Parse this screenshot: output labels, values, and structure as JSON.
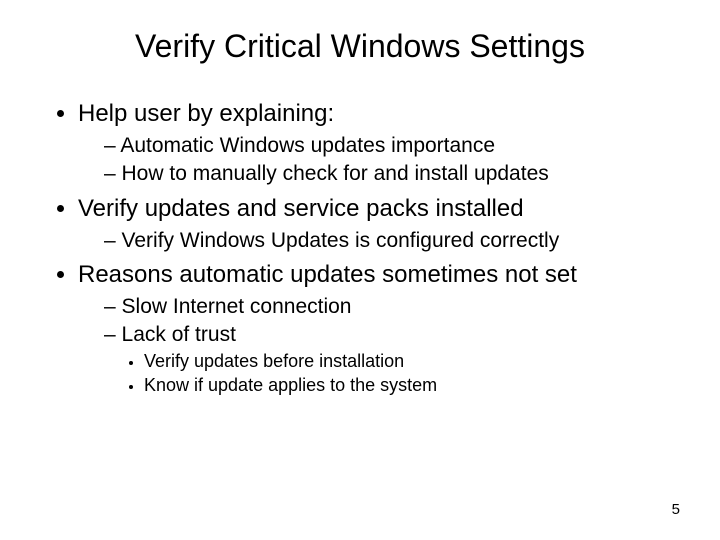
{
  "title": "Verify Critical Windows Settings",
  "bullets": [
    {
      "text": "Help user by explaining:",
      "sub": [
        {
          "text": "Automatic Windows updates importance"
        },
        {
          "text": "How to manually check for and install updates"
        }
      ]
    },
    {
      "text": "Verify updates and service packs installed",
      "sub": [
        {
          "text": "Verify Windows Updates is configured correctly"
        }
      ]
    },
    {
      "text": "Reasons automatic updates sometimes not set",
      "sub": [
        {
          "text": "Slow Internet connection"
        },
        {
          "text": "Lack of trust",
          "sub": [
            {
              "text": "Verify updates before installation"
            },
            {
              "text": "Know if update applies to the system"
            }
          ]
        }
      ]
    }
  ],
  "page_number": "5"
}
